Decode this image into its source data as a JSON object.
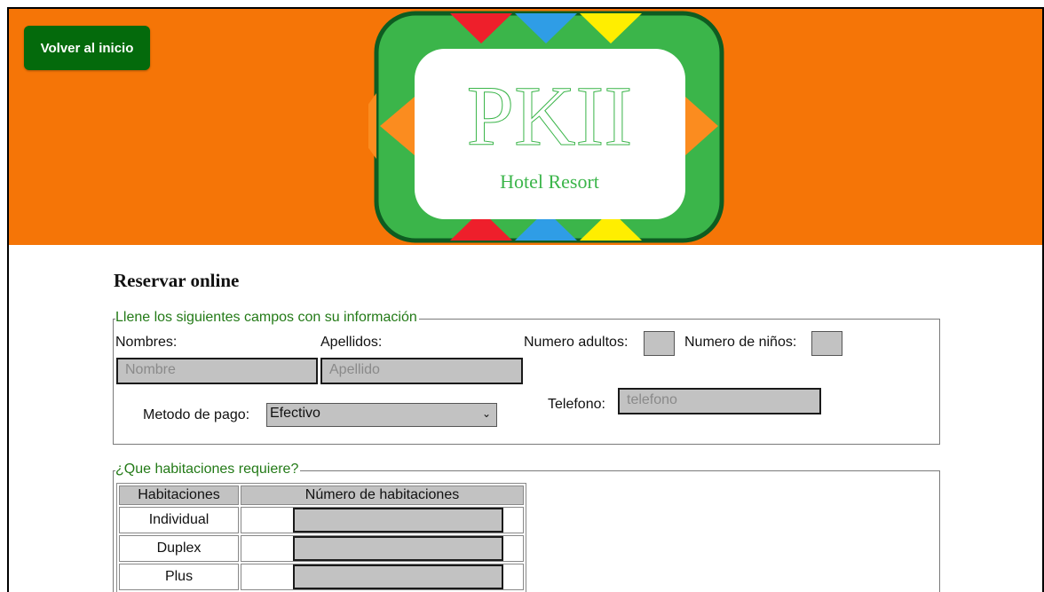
{
  "header": {
    "back_label": "Volver al inicio",
    "logo_title": "PKII",
    "logo_subtitle": "Hotel Resort",
    "colors": {
      "header_bg": "#f57507",
      "logo_green": "#3bb54a",
      "button_bg": "#046a0c"
    }
  },
  "main": {
    "title": "Reservar online"
  },
  "info_form": {
    "legend": "Llene los siguientes campos con su información",
    "first_name_label": "Nombres:",
    "first_name_placeholder": "Nombre",
    "last_name_label": "Apellidos:",
    "last_name_placeholder": "Apellido",
    "adults_label": "Numero adultos:",
    "children_label": "Numero de niños:",
    "payment_label": "Metodo de pago:",
    "payment_value": "Efectivo",
    "phone_label": "Telefono:",
    "phone_placeholder": "telefono"
  },
  "rooms_form": {
    "legend": "¿Que habitaciones requiere?",
    "headers": [
      "Habitaciones",
      "Número de habitaciones"
    ],
    "rows": [
      "Individual",
      "Duplex",
      "Plus"
    ]
  }
}
